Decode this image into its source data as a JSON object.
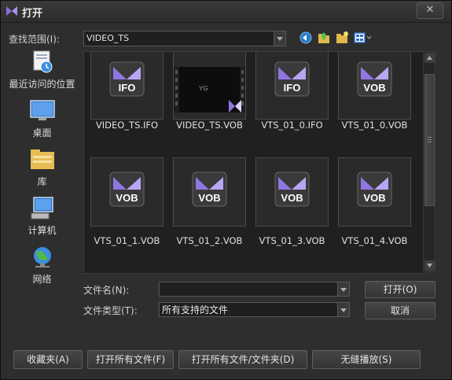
{
  "window": {
    "title": "打开",
    "close_label": "✕"
  },
  "lookin": {
    "label": "查找范围(I):",
    "value": "VIDEO_TS"
  },
  "toolbar": [
    "back-icon",
    "up-folder-icon",
    "new-folder-icon",
    "view-menu-icon"
  ],
  "places": [
    {
      "label": "最近访问的位置",
      "icon": "recent-places-icon"
    },
    {
      "label": "桌面",
      "icon": "desktop-icon"
    },
    {
      "label": "库",
      "icon": "library-icon"
    },
    {
      "label": "计算机",
      "icon": "computer-icon"
    },
    {
      "label": "网络",
      "icon": "network-icon"
    }
  ],
  "files": [
    {
      "name": "VIDEO_TS.IFO",
      "badge": "IFO"
    },
    {
      "name": "VIDEO_TS.VOB",
      "badge": ""
    },
    {
      "name": "VTS_01_0.IFO",
      "badge": "IFO"
    },
    {
      "name": "VTS_01_0.VOB",
      "badge": "VOB"
    },
    {
      "name": "VTS_01_1.VOB",
      "badge": "VOB"
    },
    {
      "name": "VTS_01_2.VOB",
      "badge": "VOB"
    },
    {
      "name": "VTS_01_3.VOB",
      "badge": "VOB"
    },
    {
      "name": "VTS_01_4.VOB",
      "badge": "VOB"
    }
  ],
  "filename": {
    "label": "文件名(N):",
    "value": ""
  },
  "filetype": {
    "label": "文件类型(T):",
    "value": "所有支持的文件"
  },
  "buttons": {
    "open": "打开(O)",
    "cancel": "取消",
    "favorites": "收藏夹(A)",
    "open_all_files": "打开所有文件(F)",
    "open_all_files_folders": "打开所有文件/文件夹(D)",
    "seamless_play": "无缝播放(S)"
  },
  "colors": {
    "accent_purple": "#7b5fd6",
    "background": "#2e2e2e"
  }
}
